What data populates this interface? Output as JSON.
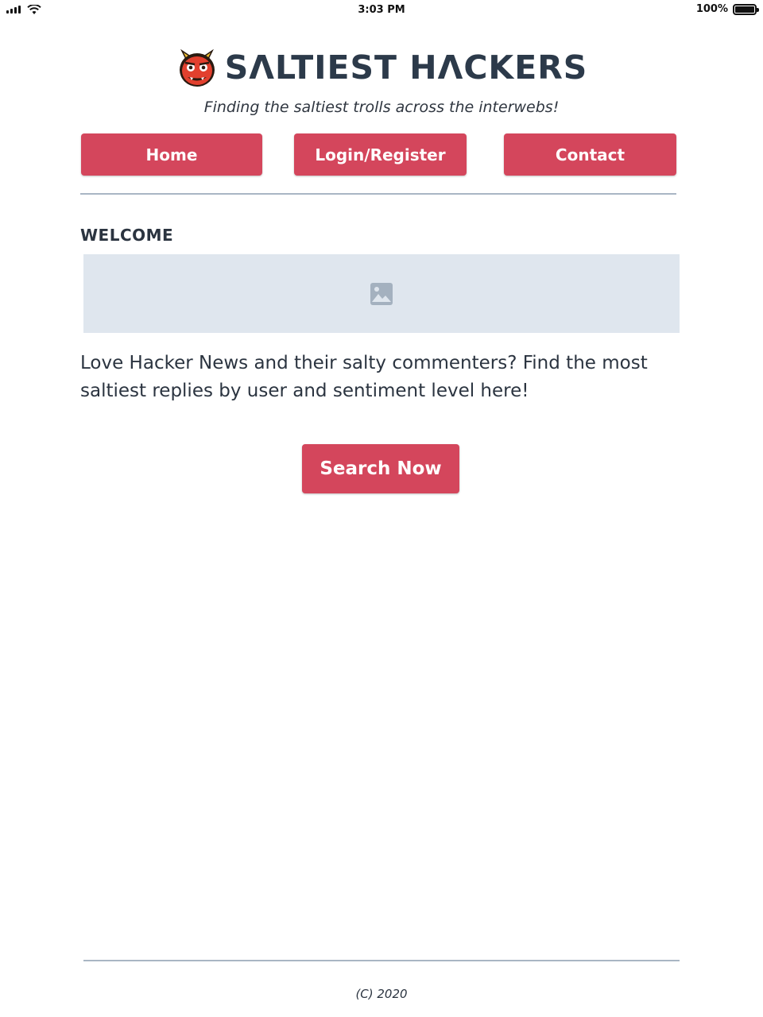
{
  "status_bar": {
    "time": "3:03 PM",
    "battery_level": "100%",
    "battery_fill": 1.0,
    "icons": [
      "signal-icon",
      "wifi-icon",
      "battery-icon"
    ]
  },
  "header": {
    "logo_icon": "ogre-mask-icon",
    "title": "SΛLTIEST HΛCKERS",
    "tagline": "Finding the saltiest trolls across the interwebs!"
  },
  "nav": {
    "items": [
      {
        "label": "Home"
      },
      {
        "label": "Login/Register"
      },
      {
        "label": "Contact"
      }
    ]
  },
  "main": {
    "section_title": "WELCOME",
    "image_icon": "image-icon",
    "intro_text": "Love Hacker News and their salty commenters? Find the most saltiest replies by user and sentiment level here!",
    "cta_label": "Search Now"
  },
  "footer": {
    "copyright": "(C) 2020"
  },
  "colors": {
    "accent": "#d4465c",
    "text": "#2b3440",
    "divider": "#a9b6c4",
    "placeholder_bg": "#dfe6ee"
  }
}
